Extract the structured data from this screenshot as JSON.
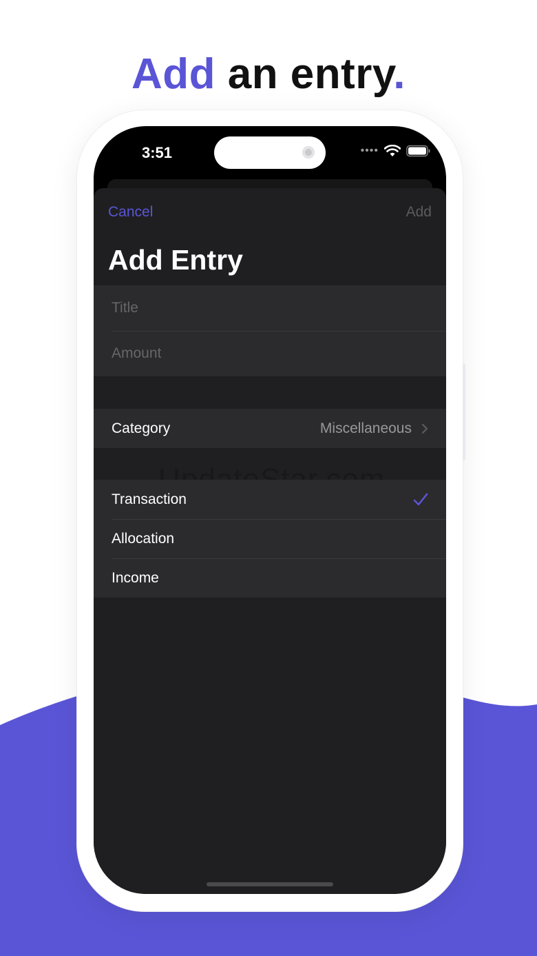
{
  "promo": {
    "headline_accent": "Add",
    "headline_rest": " an entry",
    "headline_period": "."
  },
  "status_bar": {
    "time": "3:51",
    "signal_dots": "••••"
  },
  "nav": {
    "cancel_label": "Cancel",
    "add_label": "Add"
  },
  "sheet_title": "Add Entry",
  "fields": {
    "title_placeholder": "Title",
    "amount_placeholder": "Amount"
  },
  "category": {
    "label": "Category",
    "value": "Miscellaneous"
  },
  "entry_types": {
    "items": [
      {
        "label": "Transaction",
        "selected": true
      },
      {
        "label": "Allocation",
        "selected": false
      },
      {
        "label": "Income",
        "selected": false
      }
    ]
  },
  "watermark": "UpdateStar.com",
  "colors": {
    "accent": "#5a55d6",
    "sheet_bg": "#1f1f21",
    "cell_bg": "#2b2b2d"
  },
  "icons": [
    "chevron-right-icon",
    "checkmark-icon",
    "wifi-icon",
    "battery-icon"
  ]
}
